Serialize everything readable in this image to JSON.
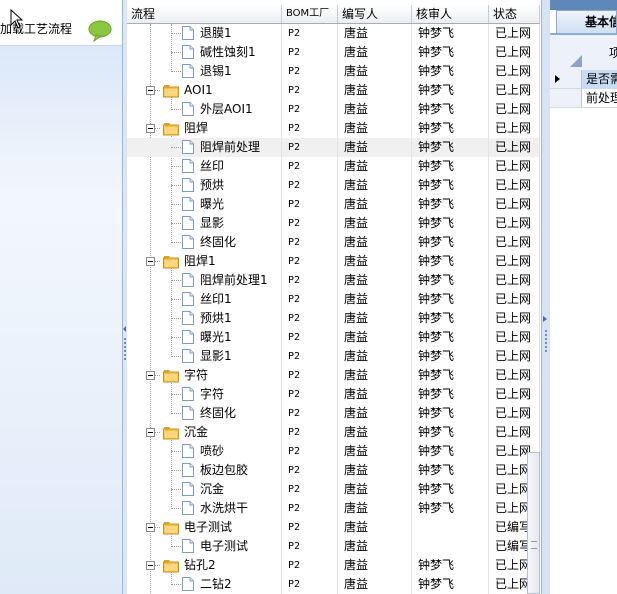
{
  "left_panel": {
    "title": "加载工艺流程",
    "title_visible": "加载工艺流程"
  },
  "grid": {
    "columns": [
      {
        "key": "flow",
        "label": "流程"
      },
      {
        "key": "bom",
        "label": "BOM工厂"
      },
      {
        "key": "author",
        "label": "编写人"
      },
      {
        "key": "reviewer",
        "label": "核审人"
      },
      {
        "key": "status",
        "label": "状态"
      }
    ],
    "rows": [
      {
        "level": 1,
        "folder": false,
        "name": "退膜1",
        "bom": "P2",
        "author": "唐益",
        "reviewer": "钟梦飞",
        "status": "已上网"
      },
      {
        "level": 1,
        "folder": false,
        "name": "碱性蚀刻1",
        "bom": "P2",
        "author": "唐益",
        "reviewer": "钟梦飞",
        "status": "已上网"
      },
      {
        "level": 1,
        "folder": false,
        "name": "退锡1",
        "bom": "P2",
        "author": "唐益",
        "reviewer": "钟梦飞",
        "status": "已上网"
      },
      {
        "level": 0,
        "folder": true,
        "name": "AOI1",
        "bom": "P2",
        "author": "唐益",
        "reviewer": "钟梦飞",
        "status": "已上网"
      },
      {
        "level": 1,
        "folder": false,
        "name": "外层AOI1",
        "bom": "P2",
        "author": "唐益",
        "reviewer": "钟梦飞",
        "status": "已上网"
      },
      {
        "level": 0,
        "folder": true,
        "name": "阻焊",
        "bom": "P2",
        "author": "唐益",
        "reviewer": "钟梦飞",
        "status": "已上网"
      },
      {
        "level": 1,
        "folder": false,
        "name": "阻焊前处理",
        "bom": "P2",
        "author": "唐益",
        "reviewer": "钟梦飞",
        "status": "已上网",
        "selected": true
      },
      {
        "level": 1,
        "folder": false,
        "name": "丝印",
        "bom": "P2",
        "author": "唐益",
        "reviewer": "钟梦飞",
        "status": "已上网"
      },
      {
        "level": 1,
        "folder": false,
        "name": "预烘",
        "bom": "P2",
        "author": "唐益",
        "reviewer": "钟梦飞",
        "status": "已上网"
      },
      {
        "level": 1,
        "folder": false,
        "name": "曝光",
        "bom": "P2",
        "author": "唐益",
        "reviewer": "钟梦飞",
        "status": "已上网"
      },
      {
        "level": 1,
        "folder": false,
        "name": "显影",
        "bom": "P2",
        "author": "唐益",
        "reviewer": "钟梦飞",
        "status": "已上网"
      },
      {
        "level": 1,
        "folder": false,
        "name": "终固化",
        "bom": "P2",
        "author": "唐益",
        "reviewer": "钟梦飞",
        "status": "已上网"
      },
      {
        "level": 0,
        "folder": true,
        "name": "阻焊1",
        "bom": "P2",
        "author": "唐益",
        "reviewer": "钟梦飞",
        "status": "已上网"
      },
      {
        "level": 1,
        "folder": false,
        "name": "阻焊前处理1",
        "bom": "P2",
        "author": "唐益",
        "reviewer": "钟梦飞",
        "status": "已上网"
      },
      {
        "level": 1,
        "folder": false,
        "name": "丝印1",
        "bom": "P2",
        "author": "唐益",
        "reviewer": "钟梦飞",
        "status": "已上网"
      },
      {
        "level": 1,
        "folder": false,
        "name": "预烘1",
        "bom": "P2",
        "author": "唐益",
        "reviewer": "钟梦飞",
        "status": "已上网"
      },
      {
        "level": 1,
        "folder": false,
        "name": "曝光1",
        "bom": "P2",
        "author": "唐益",
        "reviewer": "钟梦飞",
        "status": "已上网"
      },
      {
        "level": 1,
        "folder": false,
        "name": "显影1",
        "bom": "P2",
        "author": "唐益",
        "reviewer": "钟梦飞",
        "status": "已上网"
      },
      {
        "level": 0,
        "folder": true,
        "name": "字符",
        "bom": "P2",
        "author": "唐益",
        "reviewer": "钟梦飞",
        "status": "已上网"
      },
      {
        "level": 1,
        "folder": false,
        "name": "字符",
        "bom": "P2",
        "author": "唐益",
        "reviewer": "钟梦飞",
        "status": "已上网"
      },
      {
        "level": 1,
        "folder": false,
        "name": "终固化",
        "bom": "P2",
        "author": "唐益",
        "reviewer": "钟梦飞",
        "status": "已上网"
      },
      {
        "level": 0,
        "folder": true,
        "name": "沉金",
        "bom": "P2",
        "author": "唐益",
        "reviewer": "钟梦飞",
        "status": "已上网"
      },
      {
        "level": 1,
        "folder": false,
        "name": "喷砂",
        "bom": "P2",
        "author": "唐益",
        "reviewer": "钟梦飞",
        "status": "已上网"
      },
      {
        "level": 1,
        "folder": false,
        "name": "板边包胶",
        "bom": "P2",
        "author": "唐益",
        "reviewer": "钟梦飞",
        "status": "已上网"
      },
      {
        "level": 1,
        "folder": false,
        "name": "沉金",
        "bom": "P2",
        "author": "唐益",
        "reviewer": "钟梦飞",
        "status": "已上网"
      },
      {
        "level": 1,
        "folder": false,
        "name": "水洗烘干",
        "bom": "P2",
        "author": "唐益",
        "reviewer": "钟梦飞",
        "status": "已上网"
      },
      {
        "level": 0,
        "folder": true,
        "name": "电子测试",
        "bom": "P2",
        "author": "唐益",
        "reviewer": "",
        "status": "已编写"
      },
      {
        "level": 1,
        "folder": false,
        "name": "电子测试",
        "bom": "P2",
        "author": "唐益",
        "reviewer": "",
        "status": "已编写"
      },
      {
        "level": 0,
        "folder": true,
        "name": "钻孔2",
        "bom": "P2",
        "author": "唐益",
        "reviewer": "钟梦飞",
        "status": "已上网"
      },
      {
        "level": 1,
        "folder": false,
        "name": "二钻2",
        "bom": "P2",
        "author": "唐益",
        "reviewer": "钟梦飞",
        "status": "已上网"
      }
    ]
  },
  "right_panel": {
    "tab_label": "基本信息",
    "header_text": "项",
    "rows": [
      {
        "text": "是否需",
        "current": true
      },
      {
        "text": "前处理"
      }
    ]
  },
  "colors": {
    "selected_row": "#f0f0f0",
    "folder": "#f3c04a",
    "splitter": "#d8e6f7",
    "accent": "#5f87b8"
  },
  "icons": [
    "folder-icon",
    "document-icon",
    "expand-minus-icon",
    "chat-bubble-icon",
    "cursor-icon",
    "grip-icon"
  ]
}
